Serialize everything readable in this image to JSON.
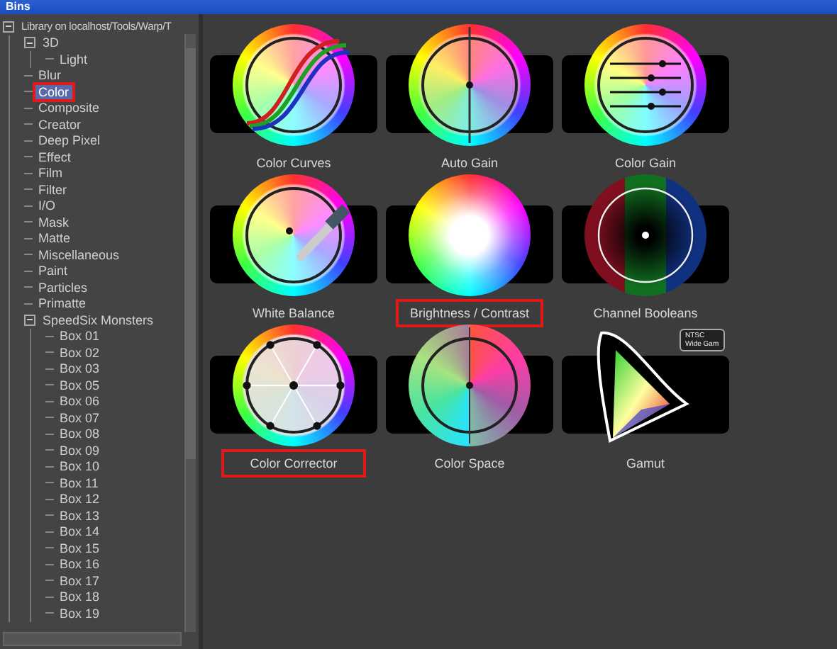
{
  "window": {
    "title": "Bins"
  },
  "tree": {
    "label": "Library on localhost/Tools/Warp/T",
    "expanded": true,
    "children": [
      {
        "label": "3D",
        "expanded": true,
        "selected": false,
        "highlighted": false,
        "children": [
          {
            "label": "Light",
            "selected": false,
            "highlighted": false
          }
        ]
      },
      {
        "label": "Blur",
        "selected": false,
        "highlighted": false
      },
      {
        "label": "Color",
        "selected": true,
        "highlighted": true
      },
      {
        "label": "Composite",
        "selected": false,
        "highlighted": false
      },
      {
        "label": "Creator",
        "selected": false,
        "highlighted": false
      },
      {
        "label": "Deep Pixel",
        "selected": false,
        "highlighted": false
      },
      {
        "label": "Effect",
        "selected": false,
        "highlighted": false
      },
      {
        "label": "Film",
        "selected": false,
        "highlighted": false
      },
      {
        "label": "Filter",
        "selected": false,
        "highlighted": false
      },
      {
        "label": "I/O",
        "selected": false,
        "highlighted": false
      },
      {
        "label": "Mask",
        "selected": false,
        "highlighted": false
      },
      {
        "label": "Matte",
        "selected": false,
        "highlighted": false
      },
      {
        "label": "Miscellaneous",
        "selected": false,
        "highlighted": false
      },
      {
        "label": "Paint",
        "selected": false,
        "highlighted": false
      },
      {
        "label": "Particles",
        "selected": false,
        "highlighted": false
      },
      {
        "label": "Primatte",
        "selected": false,
        "highlighted": false
      },
      {
        "label": "SpeedSix Monsters",
        "expanded": true,
        "selected": false,
        "highlighted": false,
        "children": [
          {
            "label": "Box 01",
            "selected": false,
            "highlighted": false
          },
          {
            "label": "Box 02",
            "selected": false,
            "highlighted": false
          },
          {
            "label": "Box 03",
            "selected": false,
            "highlighted": false
          },
          {
            "label": "Box 05",
            "selected": false,
            "highlighted": false
          },
          {
            "label": "Box 06",
            "selected": false,
            "highlighted": false
          },
          {
            "label": "Box 07",
            "selected": false,
            "highlighted": false
          },
          {
            "label": "Box 08",
            "selected": false,
            "highlighted": false
          },
          {
            "label": "Box 09",
            "selected": false,
            "highlighted": false
          },
          {
            "label": "Box 10",
            "selected": false,
            "highlighted": false
          },
          {
            "label": "Box 11",
            "selected": false,
            "highlighted": false
          },
          {
            "label": "Box 12",
            "selected": false,
            "highlighted": false
          },
          {
            "label": "Box 13",
            "selected": false,
            "highlighted": false
          },
          {
            "label": "Box 14",
            "selected": false,
            "highlighted": false
          },
          {
            "label": "Box 15",
            "selected": false,
            "highlighted": false
          },
          {
            "label": "Box 16",
            "selected": false,
            "highlighted": false
          },
          {
            "label": "Box 17",
            "selected": false,
            "highlighted": false
          },
          {
            "label": "Box 18",
            "selected": false,
            "highlighted": false
          },
          {
            "label": "Box 19",
            "selected": false,
            "highlighted": false
          }
        ]
      }
    ]
  },
  "tiles": [
    {
      "kind": "curves",
      "label": "Color Curves",
      "highlighted": false
    },
    {
      "kind": "split",
      "label": "Auto Gain",
      "highlighted": false
    },
    {
      "kind": "sliders",
      "label": "Color Gain",
      "highlighted": false
    },
    {
      "kind": "dropper",
      "label": "White Balance",
      "highlighted": false
    },
    {
      "kind": "glow",
      "label": "Brightness / Contrast",
      "highlighted": true
    },
    {
      "kind": "channels",
      "label": "Channel Booleans",
      "highlighted": false
    },
    {
      "kind": "corrector",
      "label": "Color Corrector",
      "highlighted": true
    },
    {
      "kind": "space",
      "label": "Color Space",
      "highlighted": false
    },
    {
      "kind": "gamut",
      "label": "Gamut",
      "highlighted": false,
      "callout": [
        "NTSC",
        "Wide Gam"
      ]
    }
  ]
}
